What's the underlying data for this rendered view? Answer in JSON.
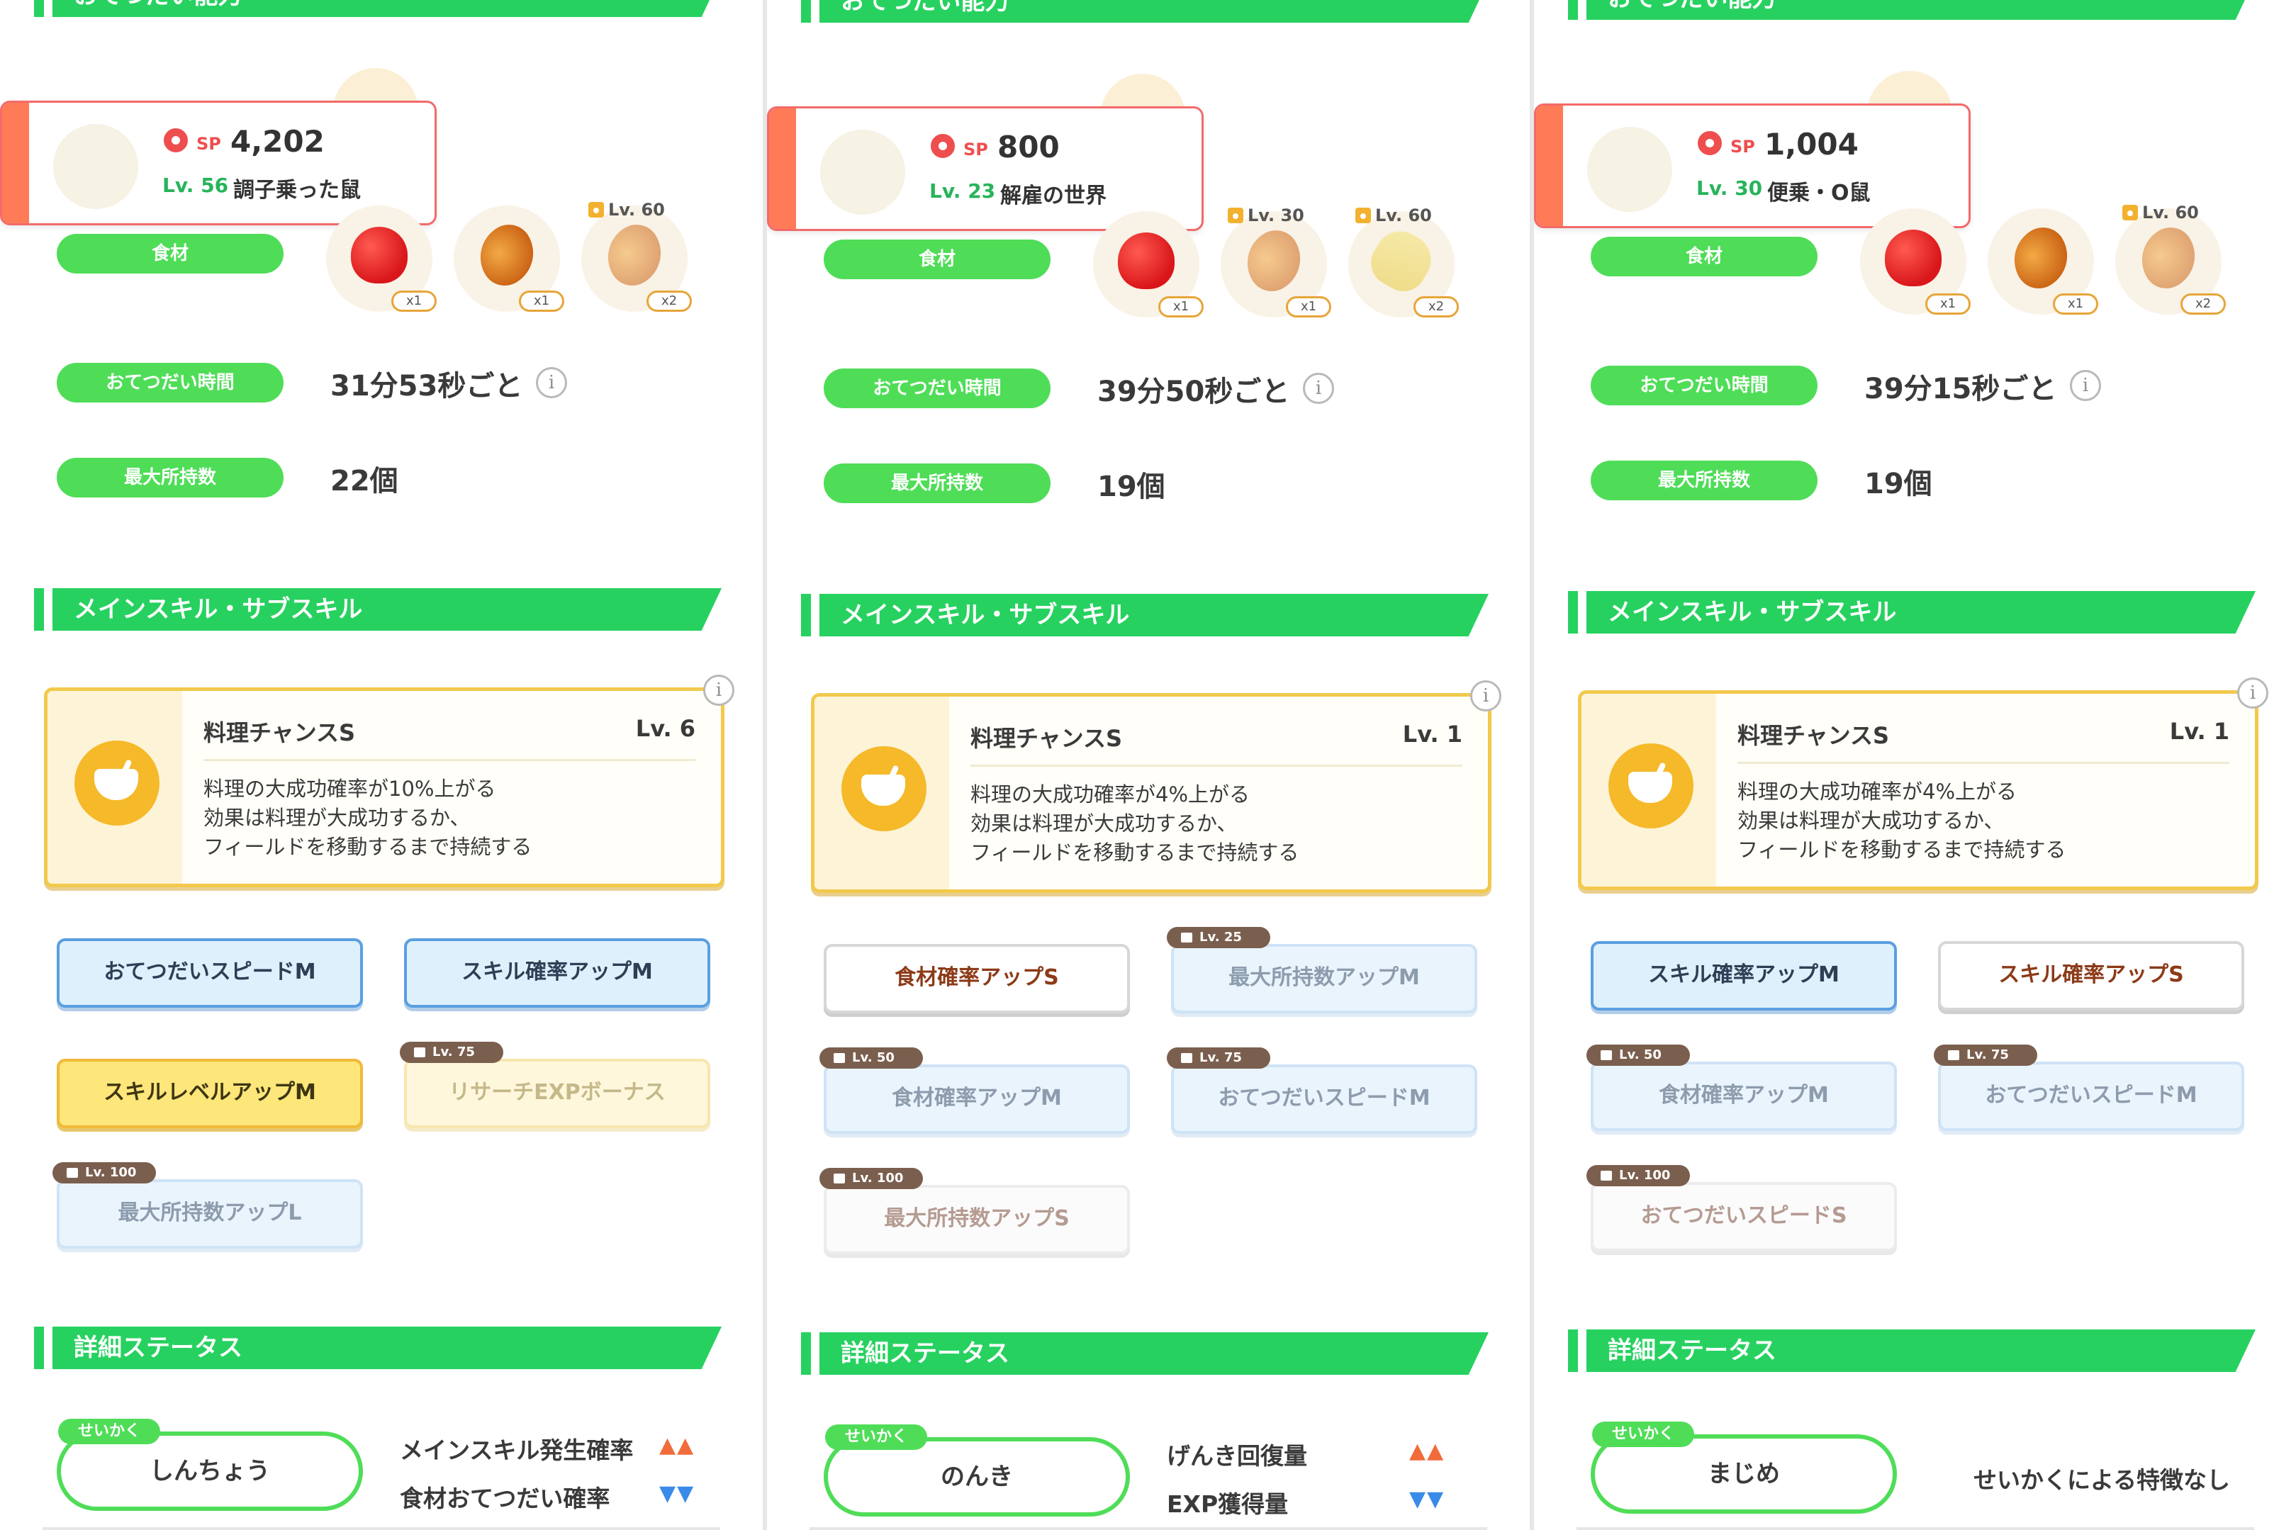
{
  "sections": {
    "help_ability": "おてつだい能力",
    "skills": "メインスキル・サブスキル",
    "details": "詳細ステータス"
  },
  "labels": {
    "ingredients": "食材",
    "help_time": "おてつだい時間",
    "max_carry": "最大所持数",
    "sp_label": "SP",
    "nature_tag": "せいかく"
  },
  "panels": [
    {
      "pokemon": {
        "sp": "4,202",
        "level": "Lv. 56",
        "name": "調子乗った鼠"
      },
      "ingredients": [
        {
          "type": "apple",
          "qty": "x1",
          "lock_level": ""
        },
        {
          "type": "bean",
          "qty": "x1",
          "lock_level": ""
        },
        {
          "type": "bean",
          "qty": "x2",
          "lock_level": "Lv. 60"
        }
      ],
      "help_time": "31分53秒ごと",
      "max_carry": "22個",
      "main_skill": {
        "name": "料理チャンスS",
        "level": "Lv. 6",
        "desc": "料理の大成功確率が10%上がる\n効果は料理が大成功するか、\nフィールドを移動するまで持続する"
      },
      "sub_skills": [
        {
          "label": "おてつだいスピードM",
          "style": "blue",
          "lock": ""
        },
        {
          "label": "スキル確率アップM",
          "style": "blue",
          "lock": ""
        },
        {
          "label": "スキルレベルアップM",
          "style": "yellow",
          "lock": ""
        },
        {
          "label": "リサーチEXPボーナス",
          "style": "yellow-locked",
          "lock": "Lv. 75"
        },
        {
          "label": "最大所持数アップL",
          "style": "blue-locked",
          "lock": "Lv. 100"
        }
      ],
      "nature": "しんちょう",
      "effects": [
        {
          "label": "メインスキル発生確率",
          "arrows": "▲▲",
          "dir": "up"
        },
        {
          "label": "食材おてつだい確率",
          "arrows": "▼▼",
          "dir": "down"
        }
      ]
    },
    {
      "pokemon": {
        "sp": "800",
        "level": "Lv. 23",
        "name": "解雇の世界"
      },
      "ingredients": [
        {
          "type": "apple",
          "qty": "x1",
          "lock_level": ""
        },
        {
          "type": "bean",
          "qty": "x1",
          "lock_level": "Lv. 30"
        },
        {
          "type": "corn",
          "qty": "x2",
          "lock_level": "Lv. 60"
        }
      ],
      "help_time": "39分50秒ごと",
      "max_carry": "19個",
      "main_skill": {
        "name": "料理チャンスS",
        "level": "Lv. 1",
        "desc": "料理の大成功確率が4%上がる\n効果は料理が大成功するか、\nフィールドを移動するまで持続する"
      },
      "sub_skills": [
        {
          "label": "食材確率アップS",
          "style": "white",
          "lock": ""
        },
        {
          "label": "最大所持数アップM",
          "style": "blue-locked",
          "lock": "Lv. 25"
        },
        {
          "label": "食材確率アップM",
          "style": "blue-locked",
          "lock": "Lv. 50"
        },
        {
          "label": "おてつだいスピードM",
          "style": "blue-locked",
          "lock": "Lv. 75"
        },
        {
          "label": "最大所持数アップS",
          "style": "white-locked",
          "lock": "Lv. 100"
        }
      ],
      "nature": "のんき",
      "effects": [
        {
          "label": "げんき回復量",
          "arrows": "▲▲",
          "dir": "up"
        },
        {
          "label": "EXP獲得量",
          "arrows": "▼▼",
          "dir": "down"
        }
      ]
    },
    {
      "pokemon": {
        "sp": "1,004",
        "level": "Lv. 30",
        "name": "便乗・O鼠"
      },
      "ingredients": [
        {
          "type": "apple",
          "qty": "x1",
          "lock_level": ""
        },
        {
          "type": "bean",
          "qty": "x1",
          "lock_level": ""
        },
        {
          "type": "bean",
          "qty": "x2",
          "lock_level": "Lv. 60"
        }
      ],
      "help_time": "39分15秒ごと",
      "max_carry": "19個",
      "main_skill": {
        "name": "料理チャンスS",
        "level": "Lv. 1",
        "desc": "料理の大成功確率が4%上がる\n効果は料理が大成功するか、\nフィールドを移動するまで持続する"
      },
      "sub_skills": [
        {
          "label": "スキル確率アップM",
          "style": "blue",
          "lock": ""
        },
        {
          "label": "スキル確率アップS",
          "style": "white",
          "lock": ""
        },
        {
          "label": "食材確率アップM",
          "style": "blue-locked",
          "lock": "Lv. 50"
        },
        {
          "label": "おてつだいスピードM",
          "style": "blue-locked",
          "lock": "Lv. 75"
        },
        {
          "label": "おてつだいスピードS",
          "style": "white-locked",
          "lock": "Lv. 100"
        }
      ],
      "nature": "まじめ",
      "effects": [
        {
          "label": "せいかくによる特徴なし",
          "arrows": "",
          "dir": ""
        }
      ]
    }
  ]
}
